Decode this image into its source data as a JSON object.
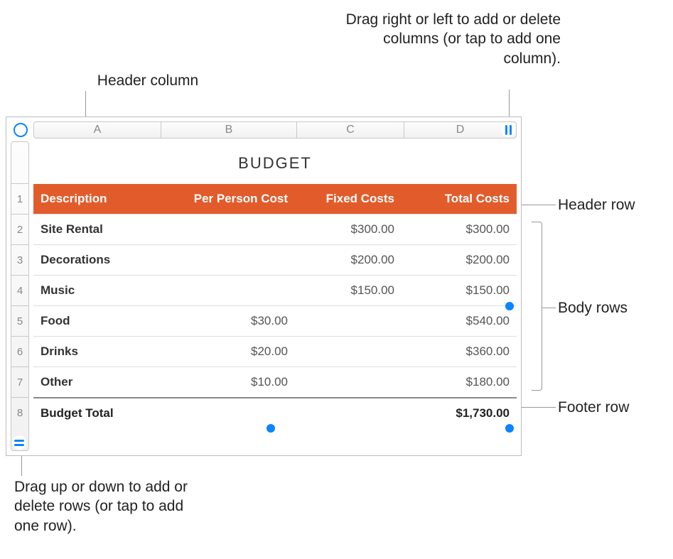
{
  "callouts": {
    "col_drag": "Drag right or left to add or delete columns (or tap to add one column).",
    "header_column": "Header column",
    "header_row": "Header row",
    "body_rows": "Body rows",
    "footer_row": "Footer row",
    "row_drag": "Drag up or down to add or delete rows (or tap to add one row)."
  },
  "colors": {
    "accent": "#0a84ff",
    "header_bg": "#e25c2b"
  },
  "table": {
    "title": "BUDGET",
    "column_letters": [
      "A",
      "B",
      "C",
      "D"
    ],
    "row_numbers": [
      "1",
      "2",
      "3",
      "4",
      "5",
      "6",
      "7",
      "8"
    ],
    "headers": {
      "description": "Description",
      "per_person": "Per Person Cost",
      "fixed": "Fixed Costs",
      "total": "Total Costs"
    },
    "rows": [
      {
        "desc": "Site Rental",
        "per": "",
        "fixed": "$300.00",
        "total": "$300.00"
      },
      {
        "desc": "Decorations",
        "per": "",
        "fixed": "$200.00",
        "total": "$200.00"
      },
      {
        "desc": "Music",
        "per": "",
        "fixed": "$150.00",
        "total": "$150.00"
      },
      {
        "desc": "Food",
        "per": "$30.00",
        "fixed": "",
        "total": "$540.00"
      },
      {
        "desc": "Drinks",
        "per": "$20.00",
        "fixed": "",
        "total": "$360.00"
      },
      {
        "desc": "Other",
        "per": "$10.00",
        "fixed": "",
        "total": "$180.00"
      }
    ],
    "footer": {
      "desc": "Budget Total",
      "total": "$1,730.00"
    }
  }
}
